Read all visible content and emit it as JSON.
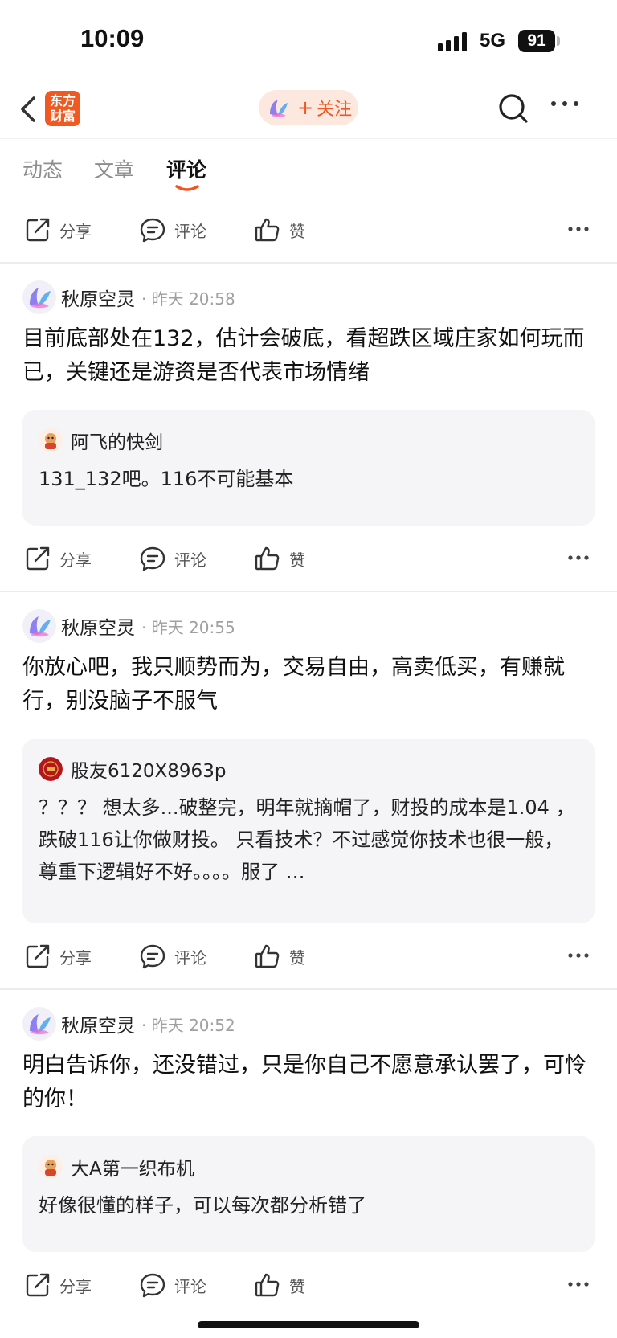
{
  "status": {
    "time": "10:09",
    "network": "5G",
    "battery": "91"
  },
  "nav": {
    "logo_line1": "东方",
    "logo_line2": "财富",
    "follow_plus": "+",
    "follow_label": "关注"
  },
  "tabs": [
    {
      "label": "动态"
    },
    {
      "label": "文章"
    },
    {
      "label": "评论"
    }
  ],
  "actions": {
    "share": "分享",
    "comment": "评论",
    "like": "赞"
  },
  "posts": [
    {
      "author": "秋原空灵",
      "time": "· 昨天 20:58",
      "text": "目前底部处在132，估计会破底，看超跌区域庄家如何玩而已，关键还是游资是否代表市场情绪",
      "quote_user": "阿飞的快剑",
      "quote_text": "131_132吧。116不可能基本"
    },
    {
      "author": "秋原空灵",
      "time": "· 昨天 20:55",
      "text": "你放心吧，我只顺势而为，交易自由，高卖低买，有赚就行，别没脑子不服气",
      "quote_user": "股友6120X8963p",
      "quote_text": "？？？ 想太多...破整完，明年就摘帽了，财投的成本是1.04 ，跌破116让你做财投。 只看技术？不过感觉你技术也很一般，尊重下逻辑好不好。。。。服了 …"
    },
    {
      "author": "秋原空灵",
      "time": "· 昨天 20:52",
      "text": "明白告诉你，还没错过，只是你自己不愿意承认罢了，可怜的你！",
      "quote_user": "大A第一织布机",
      "quote_text": "好像很懂的样子，可以每次都分析错了"
    }
  ],
  "colors": {
    "accent": "#f0561d",
    "quote_bg": "#f5f5f7",
    "muted": "#a0a0a0"
  }
}
